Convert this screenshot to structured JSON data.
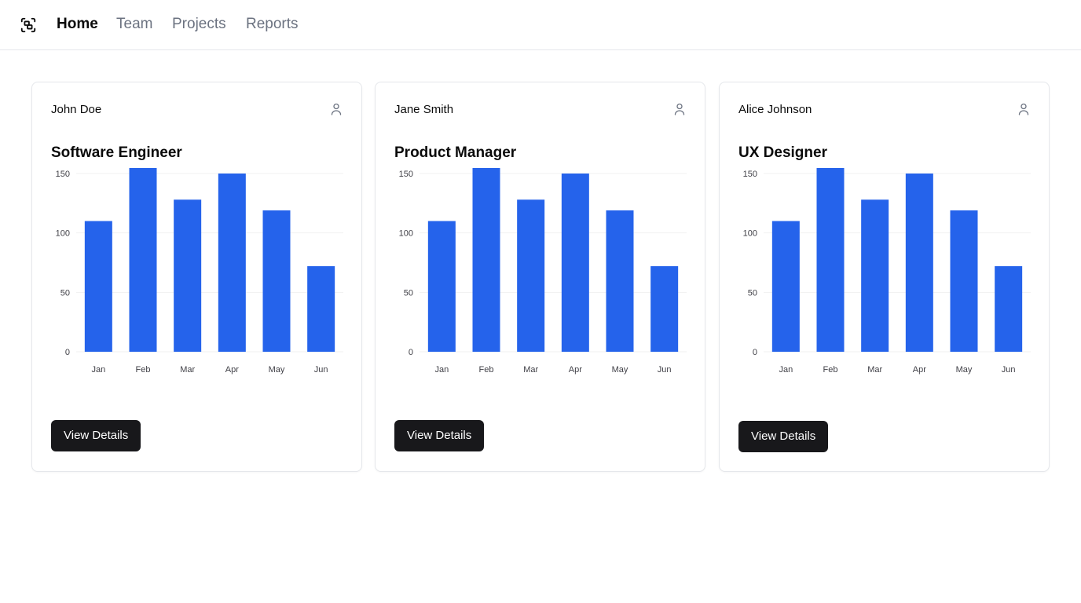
{
  "nav": {
    "logo_icon": "scan-frame-icon",
    "links": [
      {
        "label": "Home",
        "active": true
      },
      {
        "label": "Team",
        "active": false
      },
      {
        "label": "Projects",
        "active": false
      },
      {
        "label": "Reports",
        "active": false
      }
    ]
  },
  "colors": {
    "bar": "#2563eb",
    "button_bg": "#18181b",
    "nav_inactive": "#6b7280",
    "border": "#e5e7eb"
  },
  "cards": [
    {
      "name": "John Doe",
      "role": "Software Engineer",
      "icon": "user-icon",
      "button_label": "View Details"
    },
    {
      "name": "Jane Smith",
      "role": "Product Manager",
      "icon": "user-icon",
      "button_label": "View Details"
    },
    {
      "name": "Alice Johnson",
      "role": "UX Designer",
      "icon": "user-icon",
      "button_label": "View Details"
    }
  ],
  "chart_data": [
    {
      "type": "bar",
      "categories": [
        "Jan",
        "Feb",
        "Mar",
        "Apr",
        "May",
        "Jun"
      ],
      "values": [
        110,
        160,
        128,
        150,
        119,
        72
      ],
      "yticks": [
        0,
        50,
        100,
        150
      ],
      "ylim": [
        0,
        150
      ],
      "grid": true
    },
    {
      "type": "bar",
      "categories": [
        "Jan",
        "Feb",
        "Mar",
        "Apr",
        "May",
        "Jun"
      ],
      "values": [
        110,
        160,
        128,
        150,
        119,
        72
      ],
      "yticks": [
        0,
        50,
        100,
        150
      ],
      "ylim": [
        0,
        150
      ],
      "grid": true
    },
    {
      "type": "bar",
      "categories": [
        "Jan",
        "Feb",
        "Mar",
        "Apr",
        "May",
        "Jun"
      ],
      "values": [
        110,
        160,
        128,
        150,
        119,
        72
      ],
      "yticks": [
        0,
        50,
        100,
        150
      ],
      "ylim": [
        0,
        150
      ],
      "grid": true
    }
  ]
}
